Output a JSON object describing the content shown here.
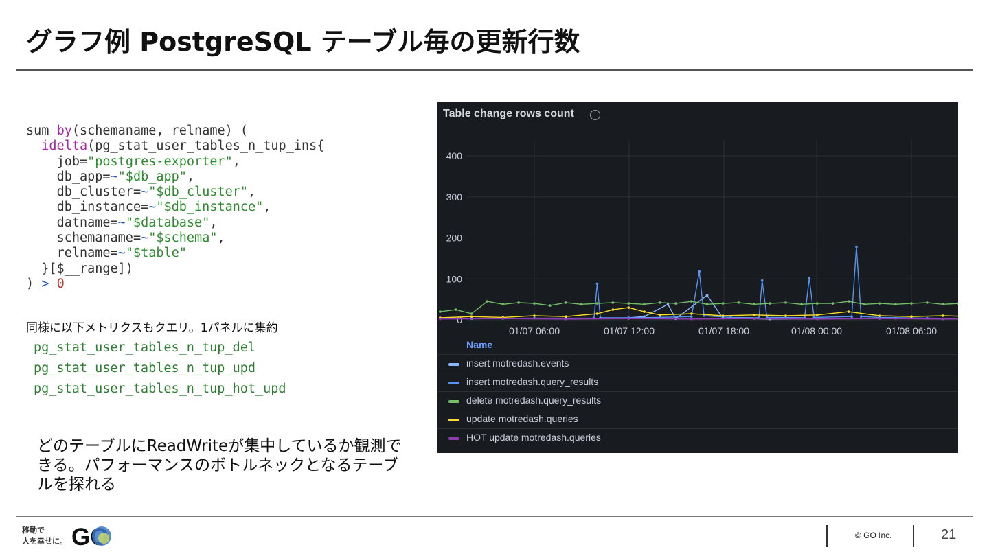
{
  "slide": {
    "title": "グラフ例 PostgreSQL テーブル毎の更新行数",
    "note": "同様に以下メトリクスもクエリ。1パネルに集約",
    "metrics": [
      "pg_stat_user_tables_n_tup_del",
      "pg_stat_user_tables_n_tup_upd",
      "pg_stat_user_tables_n_tup_hot_upd"
    ],
    "summary": "どのテーブルにReadWriteが集中しているか観測できる。パフォーマンスのボトルネックとなるテーブルを探れる",
    "footer": {
      "tagline_1": "移動で",
      "tagline_2": "人を幸せに。",
      "logo_text": "GO",
      "copyright": "© GO Inc.",
      "page": "21"
    }
  },
  "code": {
    "l1_a": "sum ",
    "l1_kw": "by",
    "l1_b": "(schemaname, relname) (",
    "l2_kw": "idelta",
    "l2_b": "(pg_stat_user_tables_n_tup_ins{",
    "l3_a": "job=",
    "l3_s": "\"postgres-exporter\"",
    "l4_a": "db_app=",
    "l4_op": "~",
    "l4_s": "\"$db_app\"",
    "l5_a": "db_cluster=",
    "l5_op": "~",
    "l5_s": "\"$db_cluster\"",
    "l6_a": "db_instance=",
    "l6_op": "~",
    "l6_s": "\"$db_instance\"",
    "l7_a": "datname=",
    "l7_op": "~",
    "l7_s": "\"$database\"",
    "l8_a": "schemaname=",
    "l8_op": "~",
    "l8_s": "\"$schema\"",
    "l9_a": "relname=",
    "l9_op": "~",
    "l9_s": "\"$table\"",
    "l10": "}[$__range])",
    "l11_a": ") ",
    "l11_op": ">",
    "l11_n": "0"
  },
  "panel": {
    "title": "Table change rows count",
    "info_icon": "info-circle-icon",
    "legend_header": "Name"
  },
  "chart_data": {
    "type": "line",
    "title": "Table change rows count",
    "x_ticks": [
      "01/07 06:00",
      "01/07 12:00",
      "01/07 18:00",
      "01/08 00:00",
      "01/08 06:00"
    ],
    "y_ticks": [
      "0",
      "100",
      "200",
      "300",
      "400"
    ],
    "ylim": [
      0,
      420
    ],
    "grid": true,
    "legend_position": "bottom",
    "series": [
      {
        "name": "insert motredash.events",
        "color": "#8ab8ff",
        "values": [
          [
            8.0,
            2
          ],
          [
            12.0,
            5
          ],
          [
            13.0,
            8
          ],
          [
            14.5,
            38
          ],
          [
            15.0,
            3
          ],
          [
            17.0,
            60
          ],
          [
            18.0,
            4
          ],
          [
            21.0,
            2
          ],
          [
            29.0,
            4
          ]
        ]
      },
      {
        "name": "insert motredash.query_results",
        "color": "#5794f2",
        "values": [
          [
            2.0,
            3
          ],
          [
            6.0,
            4
          ],
          [
            9.8,
            4
          ],
          [
            10.0,
            88
          ],
          [
            10.2,
            5
          ],
          [
            12.0,
            5
          ],
          [
            14.0,
            6
          ],
          [
            16.0,
            8
          ],
          [
            16.5,
            118
          ],
          [
            16.8,
            10
          ],
          [
            18.5,
            6
          ],
          [
            20.3,
            5
          ],
          [
            20.5,
            96
          ],
          [
            20.8,
            6
          ],
          [
            22.0,
            6
          ],
          [
            23.2,
            5
          ],
          [
            23.5,
            102
          ],
          [
            23.8,
            6
          ],
          [
            26.2,
            8
          ],
          [
            26.5,
            178
          ],
          [
            26.8,
            8
          ],
          [
            28.0,
            6
          ],
          [
            31.0,
            4
          ],
          [
            35.0,
            3
          ]
        ]
      },
      {
        "name": "delete motredash.query_results",
        "color": "#73bf69",
        "values": [
          [
            0.0,
            20
          ],
          [
            1.0,
            25
          ],
          [
            2.0,
            15
          ],
          [
            3.0,
            45
          ],
          [
            4.0,
            38
          ],
          [
            5.0,
            42
          ],
          [
            6.0,
            40
          ],
          [
            7.0,
            35
          ],
          [
            8.0,
            42
          ],
          [
            9.0,
            38
          ],
          [
            10.0,
            40
          ],
          [
            11.0,
            42
          ],
          [
            12.0,
            40
          ],
          [
            13.0,
            38
          ],
          [
            14.0,
            42
          ],
          [
            15.0,
            40
          ],
          [
            16.0,
            45
          ],
          [
            17.0,
            38
          ],
          [
            18.0,
            40
          ],
          [
            19.0,
            42
          ],
          [
            20.0,
            38
          ],
          [
            21.0,
            40
          ],
          [
            22.0,
            42
          ],
          [
            23.0,
            38
          ],
          [
            24.0,
            40
          ],
          [
            25.0,
            40
          ],
          [
            26.0,
            45
          ],
          [
            27.0,
            38
          ],
          [
            28.0,
            40
          ],
          [
            29.0,
            38
          ],
          [
            30.0,
            40
          ],
          [
            31.0,
            42
          ],
          [
            32.0,
            38
          ],
          [
            33.0,
            40
          ],
          [
            34.0,
            38
          ],
          [
            35.0,
            35
          ],
          [
            36.0,
            50
          ],
          [
            36.5,
            30
          ],
          [
            37.0,
            3
          ]
        ]
      },
      {
        "name": "update motredash.queries",
        "color": "#fade2a",
        "values": [
          [
            0.0,
            5
          ],
          [
            2.0,
            8
          ],
          [
            4.0,
            6
          ],
          [
            6.0,
            10
          ],
          [
            8.0,
            8
          ],
          [
            10.0,
            15
          ],
          [
            11.0,
            25
          ],
          [
            12.0,
            30
          ],
          [
            13.0,
            20
          ],
          [
            14.0,
            12
          ],
          [
            16.0,
            15
          ],
          [
            18.0,
            10
          ],
          [
            20.0,
            12
          ],
          [
            22.0,
            10
          ],
          [
            24.0,
            12
          ],
          [
            26.0,
            20
          ],
          [
            28.0,
            10
          ],
          [
            30.0,
            8
          ],
          [
            32.0,
            10
          ],
          [
            34.0,
            8
          ],
          [
            36.0,
            6
          ],
          [
            37.0,
            4
          ]
        ]
      },
      {
        "name": "HOT update motredash.queries",
        "color": "#8f3bb8",
        "values": [
          [
            0.0,
            2
          ],
          [
            4.0,
            3
          ],
          [
            8.0,
            2
          ],
          [
            12.0,
            3
          ],
          [
            16.0,
            2
          ],
          [
            20.0,
            3
          ],
          [
            24.0,
            2
          ],
          [
            28.0,
            3
          ],
          [
            32.0,
            2
          ],
          [
            36.0,
            3
          ],
          [
            40.0,
            2
          ],
          [
            44.0,
            3
          ],
          [
            48.0,
            2
          ]
        ]
      }
    ]
  }
}
